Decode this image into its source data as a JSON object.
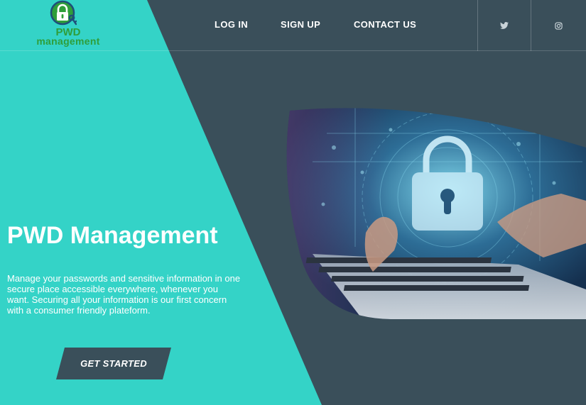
{
  "logo": {
    "line1": "PWD",
    "line2": "management",
    "icon": "padlock-key-icon"
  },
  "nav": {
    "login": "LOG IN",
    "signup": "SIGN UP",
    "contact": "CONTACT US"
  },
  "social": {
    "twitter_icon": "twitter-icon",
    "instagram_icon": "instagram-icon"
  },
  "hero": {
    "title": "PWD Management",
    "description": "Manage your passwords and sensitive information in one secure place accessible everywhere, whenever you want. Securing all your information is our first concern with a consumer friendly plateform.",
    "cta_label": "GET STARTED",
    "image_icon": "padlock-laptop-image"
  },
  "colors": {
    "teal": "#34d3c7",
    "slate": "#3a4f5a",
    "logo_green": "#2f9e3a"
  }
}
